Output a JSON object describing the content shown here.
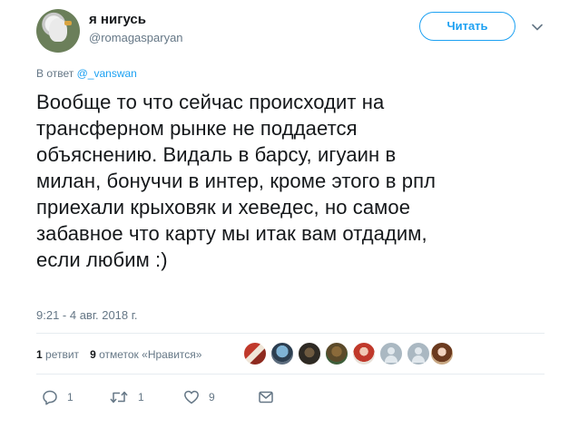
{
  "tweet": {
    "author": {
      "name": "я нигусь",
      "handle": "@romagasparyan"
    },
    "follow_label": "Читать",
    "reply_to": {
      "prefix": "В ответ",
      "mention": "@_vanswan"
    },
    "text_lines": [
      "Вообще то что сейчас происходит на",
      "трансферном рынке не поддается",
      "объяснению. Видаль в барсу, игуаин в",
      "милан, бонуччи в интер, кроме этого в рпл",
      "приехали крыховяк и хеведес, но самое",
      "забавное что карту мы итак вам отдадим,",
      "если любим :)"
    ],
    "timestamp": "9:21 - 4 авг. 2018 г.",
    "stats": {
      "retweets_count": "1",
      "retweets_label": "ретвит",
      "likes_count": "9",
      "likes_label": "отметок «Нравится»"
    },
    "actions": {
      "reply": {
        "icon": "reply-icon",
        "count": "1"
      },
      "retweet": {
        "icon": "retweet-icon",
        "count": "1"
      },
      "like": {
        "icon": "heart-icon",
        "count": "9"
      },
      "message": {
        "icon": "envelope-icon"
      }
    }
  },
  "colors": {
    "accent": "#1da1f2",
    "secondary_text": "#657786",
    "primary_text": "#14171a",
    "divider": "#e6ecf0"
  }
}
